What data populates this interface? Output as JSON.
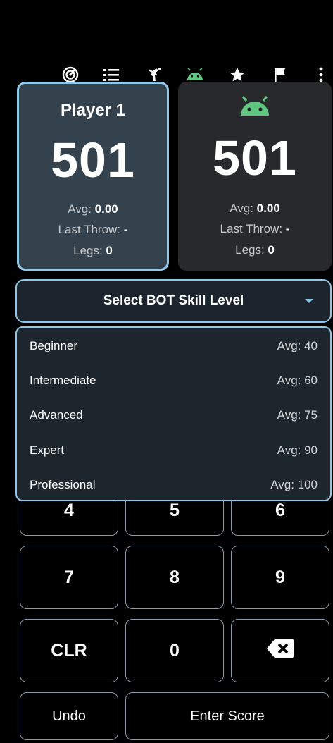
{
  "toolbar": {
    "icons": [
      "dartboard-icon",
      "list-icon",
      "hunter-icon",
      "android-bot-icon",
      "star-icon",
      "flag-icon",
      "more-vert-icon"
    ],
    "bot_color": "#5fc77f",
    "accent": "#8fc7e6"
  },
  "player1": {
    "name": "Player 1",
    "score": "501",
    "avg_label": "Avg: ",
    "avg": "0.00",
    "last_label": "Last Throw: ",
    "last": "-",
    "legs_label": "Legs: ",
    "legs": "0"
  },
  "bot": {
    "icon": "android-bot-icon",
    "score": "501",
    "avg_label": "Avg: ",
    "avg": "0.00",
    "last_label": "Last Throw: ",
    "last": "-",
    "legs_label": "Legs: ",
    "legs": "0"
  },
  "skill_select": {
    "label": "Select BOT Skill Level",
    "options": [
      {
        "name": "Beginner",
        "avg": "Avg: 40"
      },
      {
        "name": "Intermediate",
        "avg": "Avg: 60"
      },
      {
        "name": "Advanced",
        "avg": "Avg: 75"
      },
      {
        "name": "Expert",
        "avg": "Avg: 90"
      },
      {
        "name": "Professional",
        "avg": "Avg: 100"
      }
    ]
  },
  "keypad": {
    "row_hidden": [
      "4",
      "5",
      "6"
    ],
    "row3": [
      "7",
      "8",
      "9"
    ],
    "clear": "CLR",
    "zero": "0",
    "backspace_icon": "backspace-icon",
    "undo": "Undo",
    "enter": "Enter Score"
  }
}
